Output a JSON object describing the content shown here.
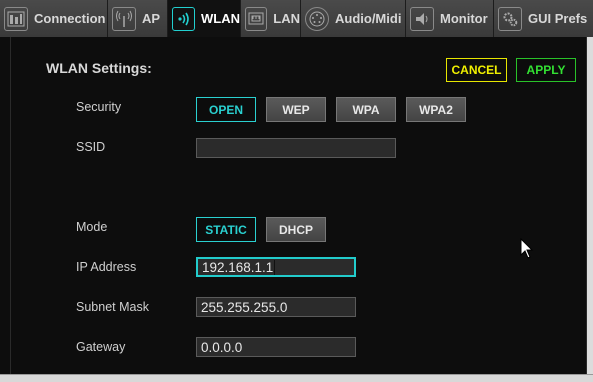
{
  "tabs": [
    {
      "label": "Connection",
      "icon": "connection-icon"
    },
    {
      "label": "AP",
      "icon": "antenna-icon"
    },
    {
      "label": "WLAN",
      "icon": "wifi-icon",
      "active": true
    },
    {
      "label": "LAN",
      "icon": "ethernet-icon"
    },
    {
      "label": "Audio/Midi",
      "icon": "midi-icon"
    },
    {
      "label": "Monitor",
      "icon": "speaker-icon"
    },
    {
      "label": "GUI Prefs",
      "icon": "gears-icon"
    }
  ],
  "settings": {
    "title": "WLAN Settings:",
    "cancel_label": "CANCEL",
    "apply_label": "APPLY"
  },
  "security": {
    "label": "Security",
    "options": [
      "OPEN",
      "WEP",
      "WPA",
      "WPA2"
    ],
    "selected": "OPEN"
  },
  "ssid": {
    "label": "SSID",
    "value": ""
  },
  "mode": {
    "label": "Mode",
    "options": [
      "STATIC",
      "DHCP"
    ],
    "selected": "STATIC"
  },
  "ip": {
    "label": "IP Address",
    "value": "192.168.1.1"
  },
  "subnet": {
    "label": "Subnet Mask",
    "value": "255.255.255.0"
  },
  "gateway": {
    "label": "Gateway",
    "value": "0.0.0.0"
  },
  "colors": {
    "accent": "#2ad0d0",
    "cancel": "#f0f000",
    "apply": "#33e033",
    "panel": "#0d0d0d"
  }
}
